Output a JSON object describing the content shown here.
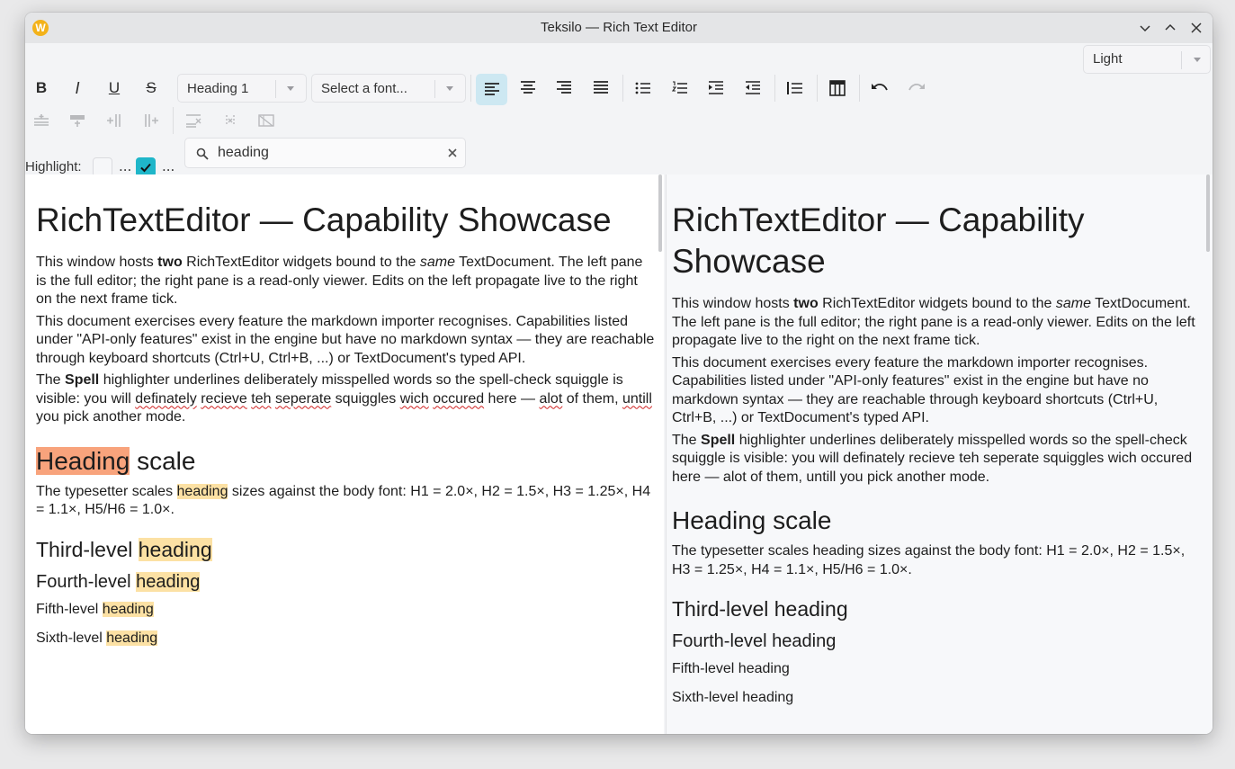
{
  "window": {
    "title": "Teksilo — Rich Text Editor",
    "logo_letter": "W"
  },
  "theme_select": {
    "value": "Light"
  },
  "toolbar": {
    "bold": "B",
    "italic": "I",
    "underline": "U",
    "strike": "S",
    "heading_combo": "Heading 1",
    "font_combo": "Select a font..."
  },
  "highlight": {
    "label": "Highlight:",
    "dots1": "...",
    "dots2": "..."
  },
  "search": {
    "query": "heading"
  },
  "left_doc": {
    "h1": "RichTextEditor — Capability Showcase",
    "p1": {
      "a": "This window hosts ",
      "b": "two",
      "c": " RichTextEditor widgets bound to the ",
      "d": "same",
      "e": " TextDocument. The left pane is the full editor; the right pane is a read-only viewer. Edits on the left propagate live to the right on the next frame tick."
    },
    "p2": "This document exercises every feature the markdown importer recognises. Capabilities listed under \"API-only features\" exist in the engine but have no markdown syntax — they are reachable through keyboard shortcuts (Ctrl+U, Ctrl+B, ...) or TextDocument's typed API.",
    "p3": {
      "a": "The ",
      "b": "Spell",
      "c": " highlighter underlines deliberately misspelled words so the spell-check squiggle is visible: you will ",
      "w1": "definately",
      "s1": " ",
      "w2": "recieve",
      "s2": " ",
      "w3": "teh",
      "s3": " ",
      "w4": "seperate",
      "c2": " squiggles ",
      "w5": "wich",
      "s5": " ",
      "w6": "occured",
      "c3": " here — ",
      "w7": "alot",
      "c4": " of them, ",
      "w8": "untill",
      "c5": " you pick another mode."
    },
    "h2": {
      "word": "Heading",
      "rest": " scale"
    },
    "p4": {
      "a": "The typesetter scales ",
      "word": "heading",
      "b": " sizes against the body font: H1 = 2.0×, H2 = 1.5×, H3 = 1.25×, H4 = 1.1×, H5/H6 = 1.0×."
    },
    "h3": {
      "a": "Third-level ",
      "word": "heading"
    },
    "h4": {
      "a": "Fourth-level ",
      "word": "heading"
    },
    "h5": {
      "a": "Fifth-level ",
      "word": "heading"
    },
    "h6": {
      "a": "Sixth-level ",
      "word": "heading"
    }
  },
  "right_doc": {
    "h1": "RichTextEditor — Capability Showcase",
    "p1": {
      "a": "This window hosts ",
      "b": "two",
      "c": " RichTextEditor widgets bound to the ",
      "d": "same",
      "e": " TextDocument. The left pane is the full editor; the right pane is a read-only viewer. Edits on the left propagate live to the right on the next frame tick."
    },
    "p2": "This document exercises every feature the markdown importer recognises. Capabilities listed under \"API-only features\" exist in the engine but have no markdown syntax — they are reachable through keyboard shortcuts (Ctrl+U, Ctrl+B, ...) or TextDocument's typed API.",
    "p3": {
      "a": "The ",
      "b": "Spell",
      "c": " highlighter underlines deliberately misspelled words so the spell-check squiggle is visible: you will definately recieve teh seperate squiggles wich occured here — alot of them, untill you pick another mode."
    },
    "h2": "Heading scale",
    "p4": "The typesetter scales heading sizes against the body font: H1 = 2.0×, H2 = 1.5×, H3 = 1.25×, H4 = 1.1×, H5/H6 = 1.0×.",
    "h3": "Third-level heading",
    "h4": "Fourth-level heading",
    "h5": "Fifth-level heading",
    "h6": "Sixth-level heading"
  },
  "colors": {
    "accent": "#1fb6c9",
    "active_bg": "#cde8f2",
    "match": "#fce1a4",
    "current_match": "#f8a37c",
    "spell": "#d02020"
  }
}
